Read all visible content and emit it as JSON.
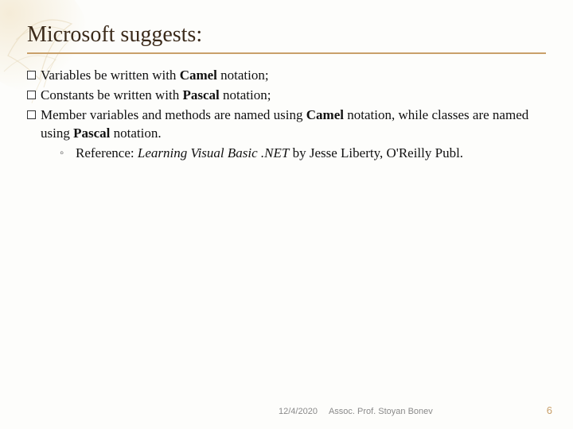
{
  "slide": {
    "title": "Microsoft suggests:",
    "bullets": [
      {
        "pre": "Variables be written with ",
        "bold": "Camel",
        "post": " notation;"
      },
      {
        "pre": "Constants be written with ",
        "bold": "Pascal",
        "post": " notation;"
      },
      {
        "pre": "Member variables and methods are named using ",
        "bold": "Camel",
        "mid": " notation, while classes are named using ",
        "bold2": "Pascal",
        "post": " notation."
      }
    ],
    "sub": {
      "marker": "◦",
      "pre": "Reference: ",
      "italic": "Learning Visual Basic .NET",
      "post": " by Jesse Liberty, O'Reilly Publ."
    }
  },
  "footer": {
    "date": "12/4/2020",
    "author": "Assoc. Prof. Stoyan Bonev",
    "page": "6"
  }
}
